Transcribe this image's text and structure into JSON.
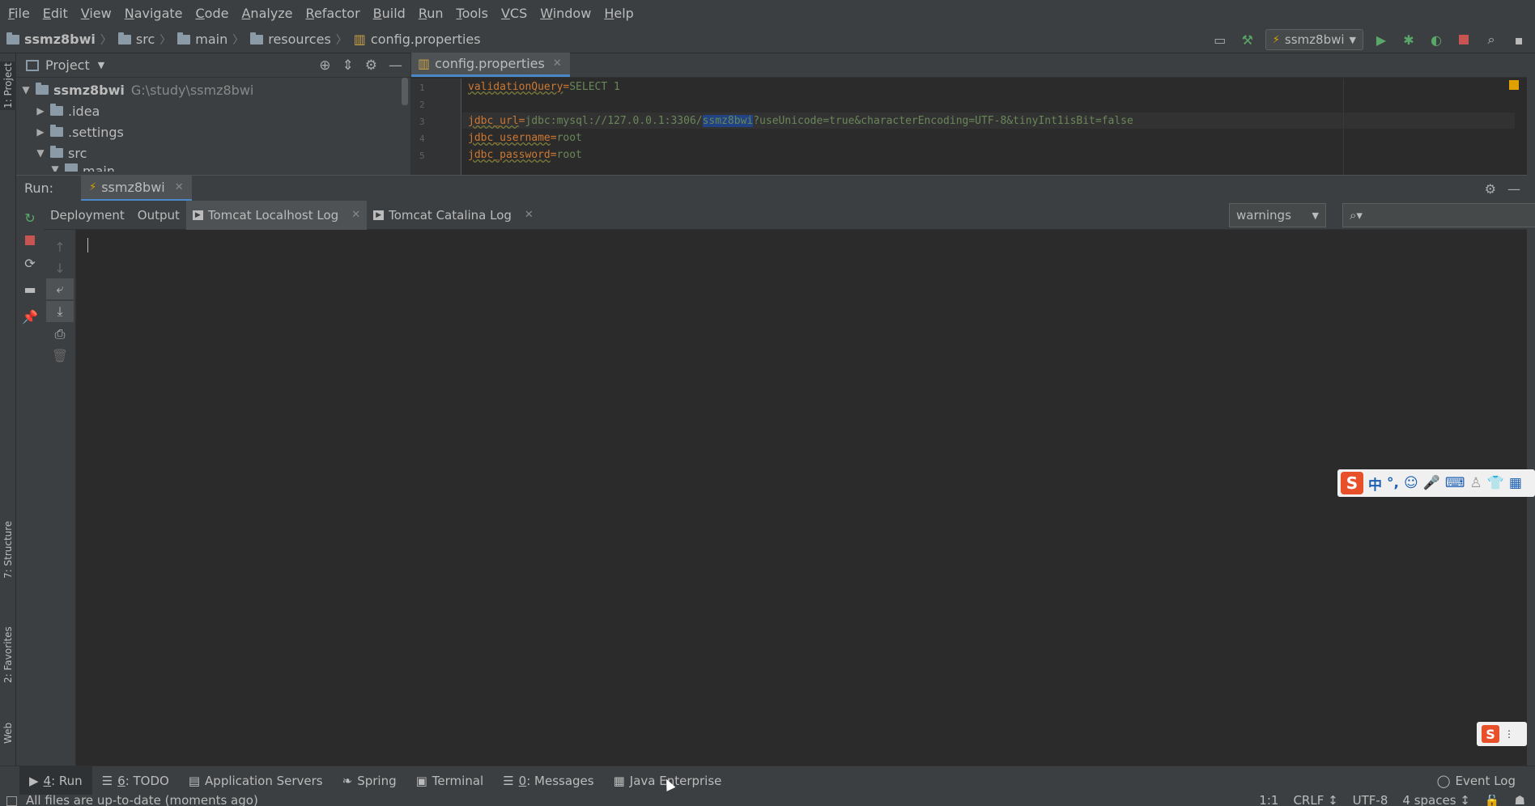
{
  "menu": [
    "File",
    "Edit",
    "View",
    "Navigate",
    "Code",
    "Analyze",
    "Refactor",
    "Build",
    "Run",
    "Tools",
    "VCS",
    "Window",
    "Help"
  ],
  "breadcrumb": [
    "ssmz8bwi",
    "src",
    "main",
    "resources",
    "config.properties"
  ],
  "toolbar": {
    "run_config": "ssmz8bwi"
  },
  "project_panel": {
    "title": "Project",
    "tree": [
      {
        "name": "ssmz8bwi",
        "path": "G:\\study\\ssmz8bwi",
        "expanded": true
      },
      {
        "name": ".idea",
        "expanded": false
      },
      {
        "name": ".settings",
        "expanded": false
      },
      {
        "name": "src",
        "expanded": true
      },
      {
        "name": "main",
        "expanded": true
      }
    ],
    "side_tab": "1: Project"
  },
  "editor": {
    "tab": "config.properties",
    "lines": [
      {
        "num": "1",
        "key": "validationQuery",
        "value": "SELECT 1"
      },
      {
        "num": "2",
        "key": "",
        "value": ""
      },
      {
        "num": "3",
        "key": "jdbc_url",
        "value_pre": "jdbc:mysql://127.0.0.1:3306/",
        "value_sel": "ssmz8bwi",
        "value_post": "?useUnicode=true&characterEncoding=UTF-8&tinyInt1isBit=false"
      },
      {
        "num": "4",
        "key": "jdbc_username",
        "value": "root"
      },
      {
        "num": "5",
        "key": "jdbc_password",
        "value": "root"
      }
    ]
  },
  "run_panel": {
    "label": "Run:",
    "tab": "ssmz8bwi",
    "subtabs": [
      "Deployment",
      "Output",
      "Tomcat Localhost Log",
      "Tomcat Catalina Log"
    ],
    "active_subtab": "Tomcat Localhost Log",
    "filter_value": "warnings",
    "search_placeholder": ""
  },
  "side_tabs_left": [
    "7: Structure",
    "2: Favorites",
    "Web"
  ],
  "bottom_tabs": [
    {
      "num": "4",
      "label": ": Run",
      "icon": "play-icon"
    },
    {
      "num": "6",
      "label": ": TODO",
      "icon": "list-icon"
    },
    {
      "num": "",
      "label": "Application Servers",
      "icon": "server-icon"
    },
    {
      "num": "",
      "label": "Spring",
      "icon": "leaf-icon"
    },
    {
      "num": "",
      "label": "Terminal",
      "icon": "terminal-icon"
    },
    {
      "num": "0",
      "label": ": Messages",
      "icon": "messages-icon"
    },
    {
      "num": "",
      "label": "Java Enterprise",
      "icon": "enterprise-icon"
    }
  ],
  "event_log": "Event Log",
  "status": {
    "message": "All files are up-to-date (moments ago)",
    "position": "1:1",
    "line_sep": "CRLF ↕",
    "encoding": "UTF-8",
    "indent": "4 spaces ↕"
  },
  "ime": {
    "label": "中",
    "brand": "S"
  },
  "colors": {
    "accent": "#4a88c7",
    "background": "#2b2b2b",
    "panel": "#3c3f41",
    "run_green": "#59a869",
    "stop_red": "#c75450"
  }
}
